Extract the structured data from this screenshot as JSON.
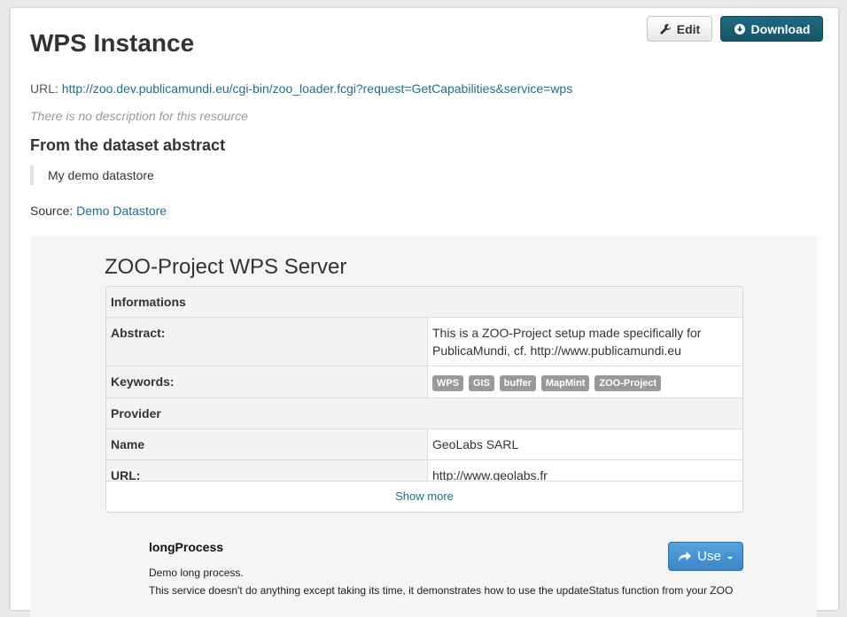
{
  "header": {
    "title": "WPS Instance",
    "edit_label": "Edit",
    "download_label": "Download"
  },
  "resource": {
    "url_label": "URL:",
    "url": "http://zoo.dev.publicamundi.eu/cgi-bin/zoo_loader.fcgi?request=GetCapabilities&service=wps",
    "no_description": "There is no description for this resource",
    "abstract_heading": "From the dataset abstract",
    "abstract_text": "My demo datastore",
    "source_label": "Source:",
    "source_link": "Demo Datastore"
  },
  "wps": {
    "title": "ZOO-Project WPS Server",
    "informations_header": "Informations",
    "abstract_label": "Abstract:",
    "abstract_value": "This is a ZOO-Project setup made specifically for PublicaMundi, cf. http://www.publicamundi.eu",
    "keywords_label": "Keywords:",
    "keywords": [
      "WPS",
      "GIS",
      "buffer",
      "MapMint",
      "ZOO-Project"
    ],
    "provider_header": "Provider",
    "name_label": "Name",
    "name_value": "GeoLabs SARL",
    "url_label": "URL:",
    "url_value": "http://www.geolabs.fr",
    "show_more": "Show more"
  },
  "process": {
    "name": "longProcess",
    "use_label": "Use",
    "description": "Demo long process.",
    "detail": "This service doesn't do anything except taking its time, it demonstrates how to use the updateStatus function from your ZOO"
  },
  "colors": {
    "link": "#1f6f8b",
    "download_button": "#175468",
    "use_button": "#3b86c6",
    "badge": "#999999"
  }
}
